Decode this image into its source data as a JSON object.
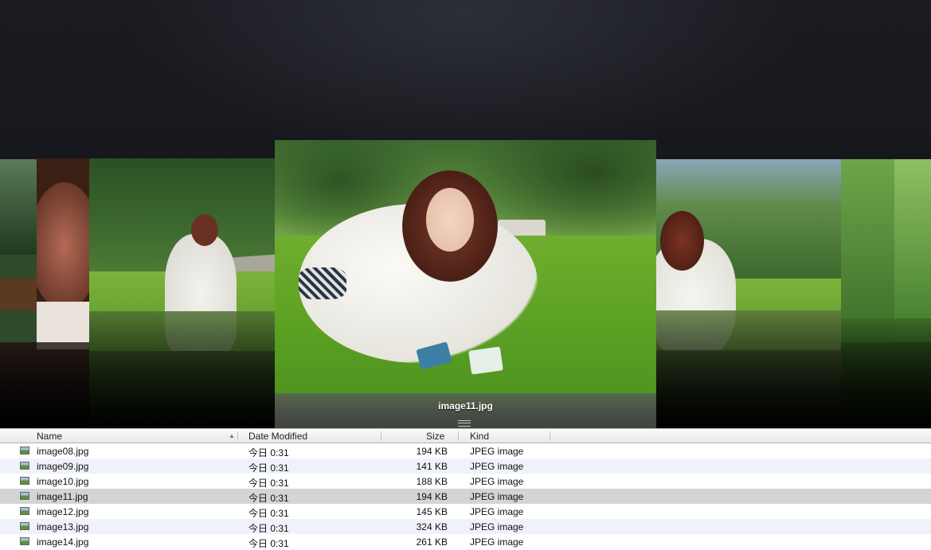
{
  "coverflow": {
    "selected_caption": "image11.jpg"
  },
  "list": {
    "columns": {
      "name": "Name",
      "date": "Date Modified",
      "size": "Size",
      "kind": "Kind"
    },
    "sort_indicator": "▲",
    "rows": [
      {
        "name": "image08.jpg",
        "date": "今日 0:31",
        "size": "194 KB",
        "kind": "JPEG image"
      },
      {
        "name": "image09.jpg",
        "date": "今日 0:31",
        "size": "141 KB",
        "kind": "JPEG image"
      },
      {
        "name": "image10.jpg",
        "date": "今日 0:31",
        "size": "188 KB",
        "kind": "JPEG image"
      },
      {
        "name": "image11.jpg",
        "date": "今日 0:31",
        "size": "194 KB",
        "kind": "JPEG image"
      },
      {
        "name": "image12.jpg",
        "date": "今日 0:31",
        "size": "145 KB",
        "kind": "JPEG image"
      },
      {
        "name": "image13.jpg",
        "date": "今日 0:31",
        "size": "324 KB",
        "kind": "JPEG image"
      },
      {
        "name": "image14.jpg",
        "date": "今日 0:31",
        "size": "261 KB",
        "kind": "JPEG image"
      }
    ]
  },
  "colors": {
    "selected_row": "#d4d4d4",
    "alt_row": "#eff3f9",
    "grass": "#6fae2e",
    "trees": "#2f5a26"
  }
}
